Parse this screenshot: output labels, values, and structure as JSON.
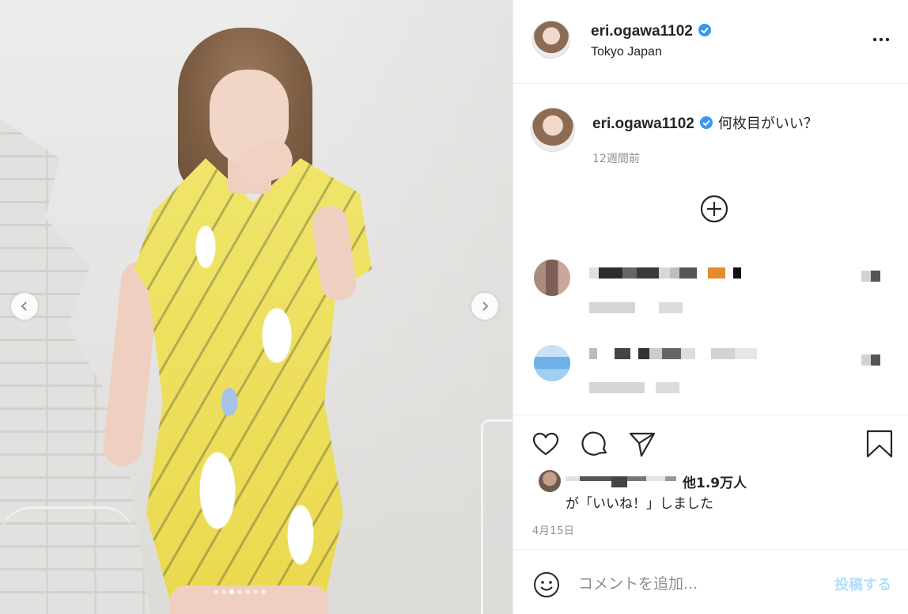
{
  "post": {
    "username": "eri.ogawa1102",
    "location": "Tokyo Japan",
    "caption": "何枚目がいい？",
    "time_ago": "12週間前",
    "date": "4月15日",
    "likes_count_label": "他1.9万人",
    "likes_suffix": "が「いいね！」しました",
    "carousel": {
      "total_slides": 7,
      "active_slide": 3
    }
  },
  "comment_box": {
    "placeholder": "コメントを追加...",
    "post_label": "投稿する"
  },
  "icons": {
    "verified": "verified-badge-icon",
    "more": "more-options-icon",
    "load_more": "load-more-comments-icon",
    "like": "heart-icon",
    "comment": "comment-icon",
    "share": "share-icon",
    "save": "bookmark-icon",
    "emoji": "emoji-icon",
    "prev": "chevron-left-icon",
    "next": "chevron-right-icon"
  },
  "colors": {
    "verified_blue": "#3897f0",
    "post_button_disabled": "#b2dffc",
    "text_primary": "#262626",
    "text_secondary": "#8e8e8e"
  }
}
